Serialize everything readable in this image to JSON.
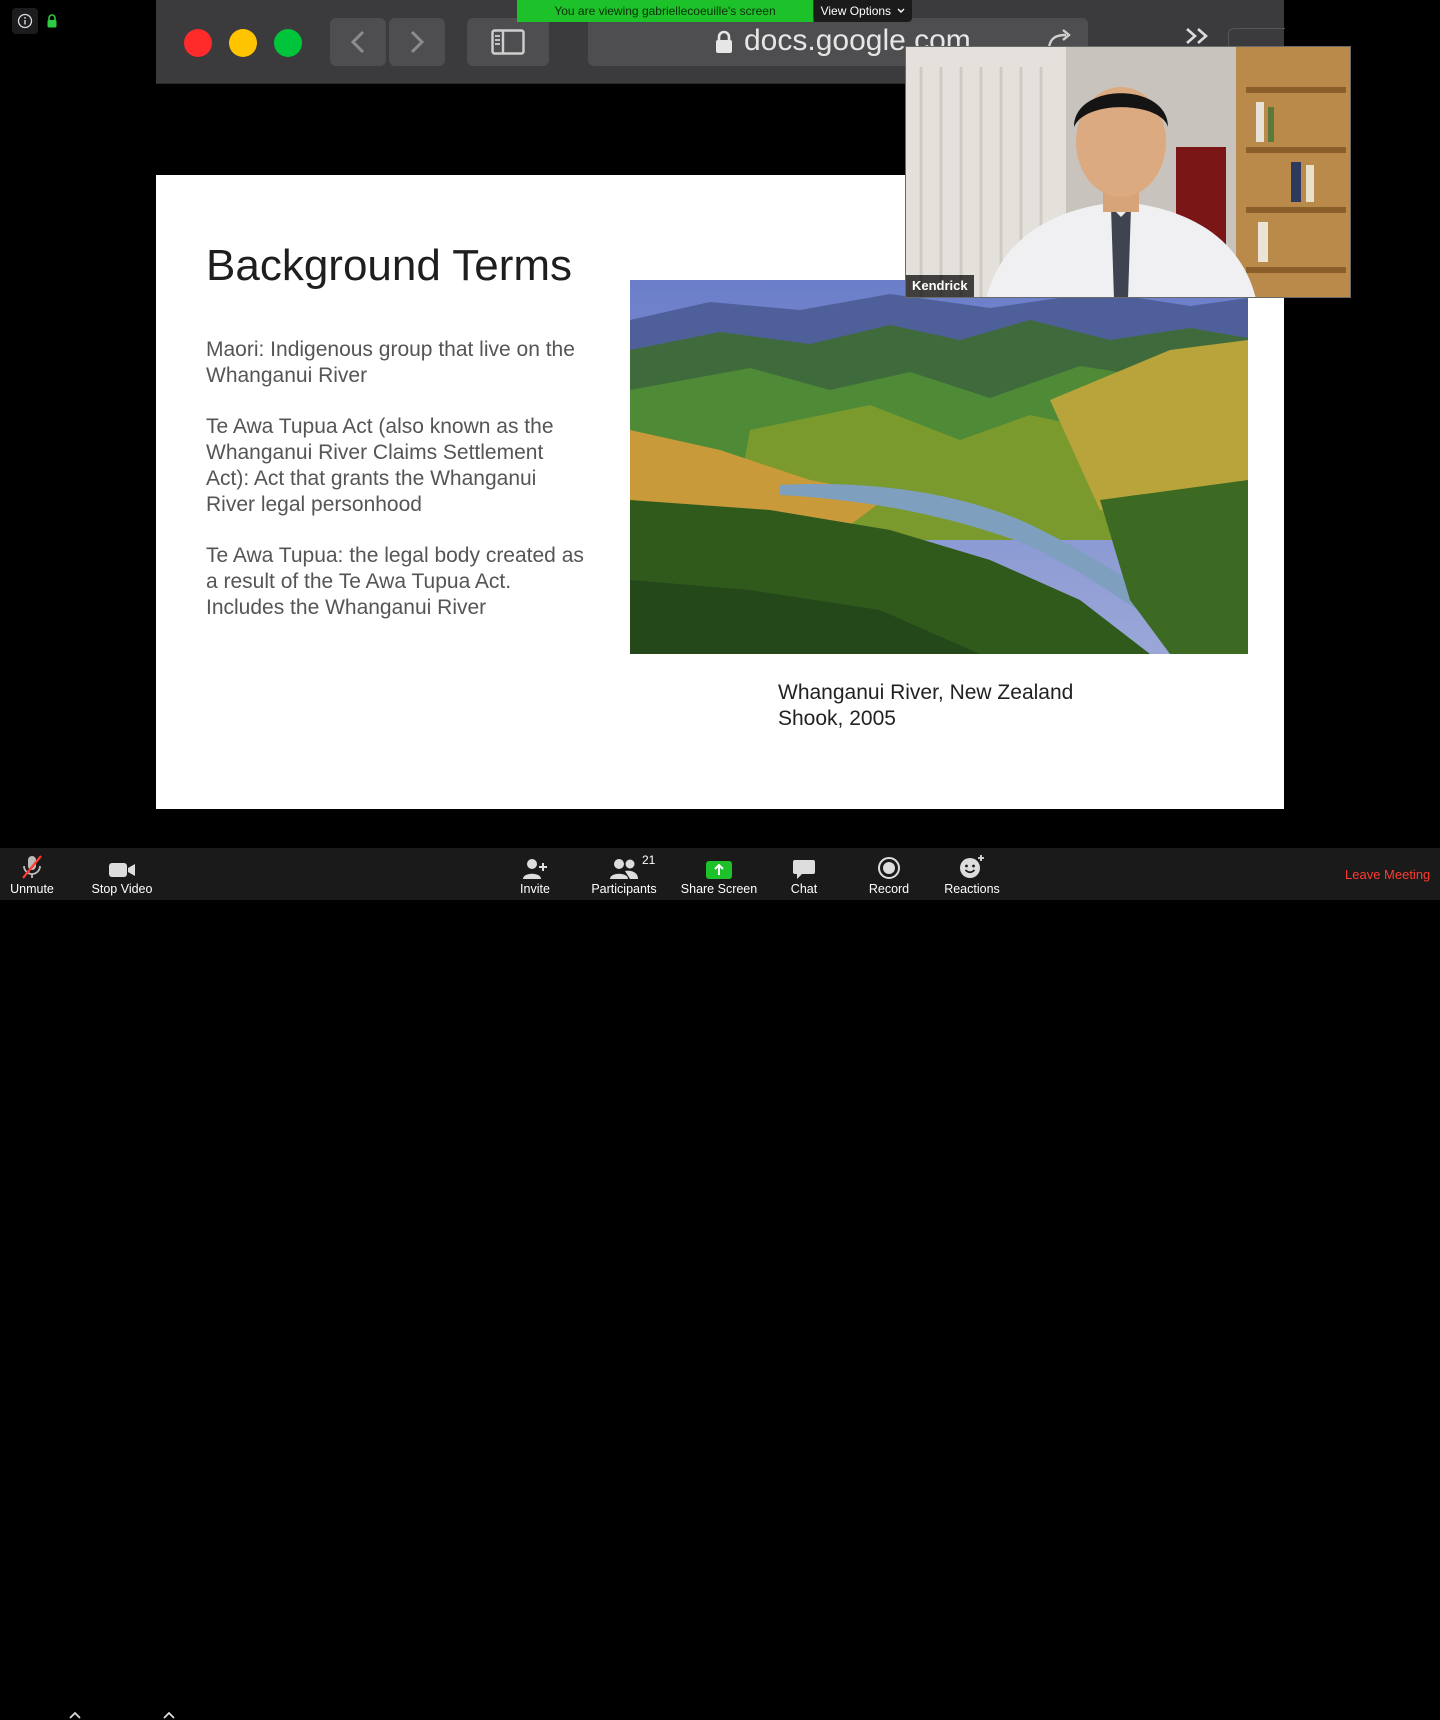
{
  "screen_share": {
    "banner_text": "You are viewing gabriellecoeuille's screen",
    "view_options_label": "View Options"
  },
  "browser": {
    "url": "docs.google.com"
  },
  "slide": {
    "title": "Background Terms",
    "paragraphs": [
      "Maori: Indigenous group that live on the Whanganui River",
      "Te Awa Tupua Act (also known as the Whanganui River Claims Settlement Act): Act that grants the Whanganui River legal personhood",
      "Te Awa Tupua: the legal body created as a result of the Te Awa Tupua Act. Includes the Whanganui River"
    ],
    "caption_line1": "Whanganui River, New Zealand",
    "caption_line2": "Shook, 2005"
  },
  "video": {
    "participant_name": "Kendrick"
  },
  "toolbar": {
    "unmute_label": "Unmute",
    "stop_video_label": "Stop Video",
    "invite_label": "Invite",
    "participants_label": "Participants",
    "participants_count": "21",
    "share_screen_label": "Share Screen",
    "chat_label": "Chat",
    "record_label": "Record",
    "reactions_label": "Reactions",
    "leave_label": "Leave Meeting"
  },
  "colors": {
    "share_green": "#1dc22b",
    "leave_red": "#ff3b30",
    "traffic_red": "#ff2a2a",
    "traffic_yellow": "#ffc400",
    "traffic_green": "#00c53a"
  }
}
